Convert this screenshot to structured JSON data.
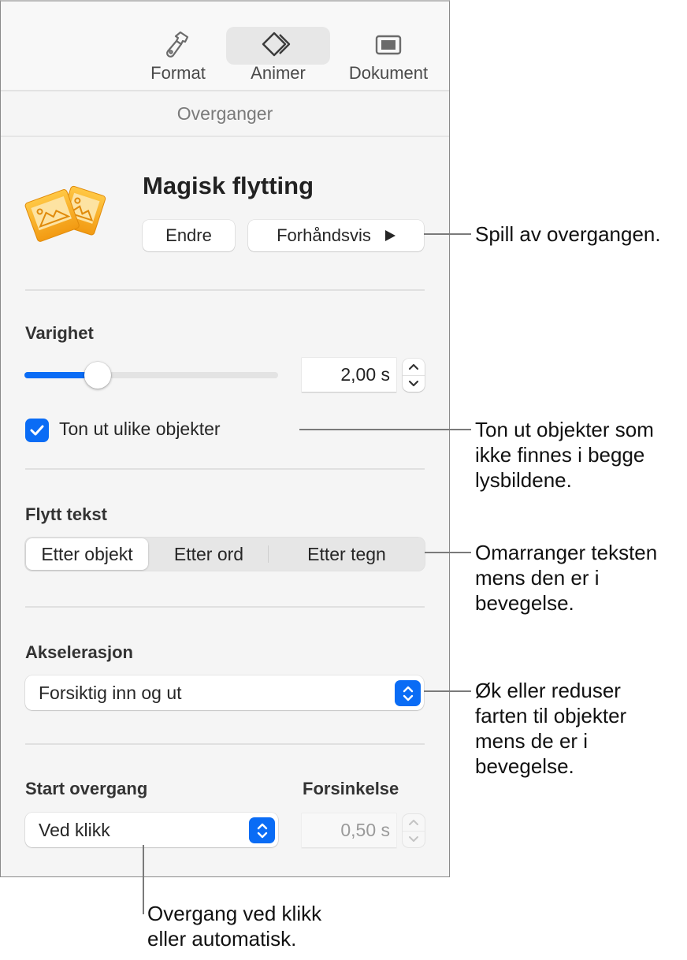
{
  "toolbar": {
    "tabs": [
      {
        "label": "Format",
        "icon": "paintbrush-icon",
        "active": false
      },
      {
        "label": "Animer",
        "icon": "animate-diamonds-icon",
        "active": true
      },
      {
        "label": "Dokument",
        "icon": "document-icon",
        "active": false
      }
    ]
  },
  "section_tab": "Overganger",
  "transition": {
    "icon": "magic-move-photos-icon",
    "title": "Magisk flytting",
    "change_label": "Endre",
    "preview_label": "Forhåndsvis"
  },
  "duration": {
    "label": "Varighet",
    "slider_fraction": 0.29,
    "value": "2,00 s"
  },
  "fade_checkbox": {
    "label": "Ton ut ulike objekter",
    "checked": true
  },
  "move_text": {
    "label": "Flytt tekst",
    "options": [
      "Etter objekt",
      "Etter ord",
      "Etter tegn"
    ],
    "selected": "Etter objekt"
  },
  "acceleration": {
    "label": "Akselerasjon",
    "value": "Forsiktig inn og ut"
  },
  "start": {
    "label": "Start overgang",
    "value": "Ved klikk"
  },
  "delay": {
    "label": "Forsinkelse",
    "value": "0,50 s",
    "enabled": false
  },
  "colors": {
    "accent": "#0a6cf5",
    "icon_orange": "#f0a020"
  },
  "callouts": [
    {
      "text": "Spill av overgangen."
    },
    {
      "text": "Ton ut objekter som ikke finnes i begge lysbildene."
    },
    {
      "text": "Omarranger teksten mens den er i bevegelse."
    },
    {
      "text": "Øk eller reduser farten til objekter mens de er i bevegelse."
    },
    {
      "text": "Overgang ved klikk eller automatisk."
    }
  ]
}
